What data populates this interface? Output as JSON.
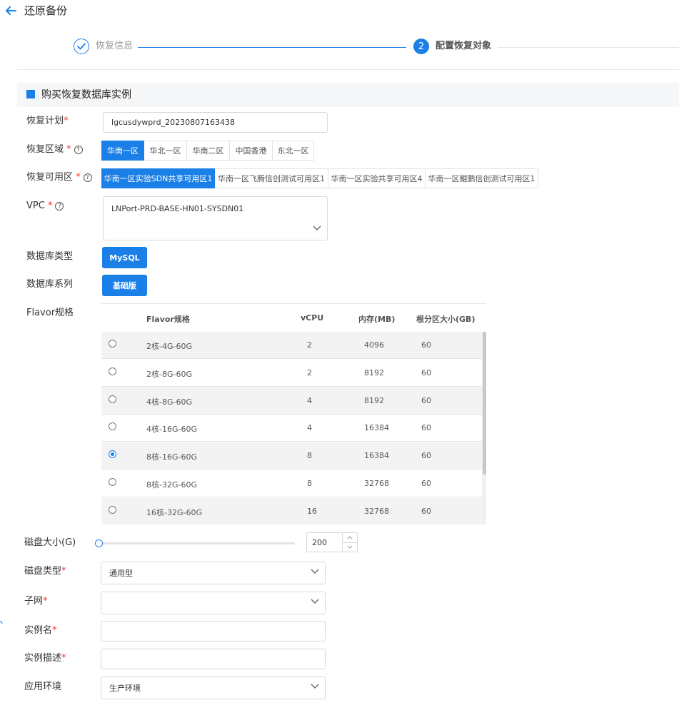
{
  "header": {
    "title": "还原备份",
    "back_icon": "arrow-left-icon"
  },
  "steps": [
    {
      "label": "恢复信息",
      "state": "done",
      "icon": "check-icon"
    },
    {
      "number": "2",
      "label": "配置恢复对象",
      "state": "active"
    }
  ],
  "section": {
    "title": "购买恢复数据库实例"
  },
  "form": {
    "plan": {
      "label": "恢复计划",
      "required_mark": "*",
      "value": "lgcusdywprd_20230807163438"
    },
    "region": {
      "label": "恢复区域",
      "required_mark": "*",
      "options": [
        "华南一区",
        "华北一区",
        "华南二区",
        "中国香港",
        "东北一区"
      ],
      "selected": "华南一区"
    },
    "zone": {
      "label": "恢复可用区",
      "required_mark": "*",
      "options": [
        "华南一区实验SDN共享可用区1",
        "华南一区飞腾信创测试可用区1",
        "华南一区实验共享可用区4",
        "华南一区鲲鹏信创测试可用区1"
      ],
      "selected": "华南一区实验SDN共享可用区1"
    },
    "vpc": {
      "label": "VPC",
      "required_mark": "*",
      "value": "LNPort-PRD-BASE-HN01-SYSDN01"
    },
    "db_type": {
      "label": "数据库类型",
      "value": "MySQL"
    },
    "db_series": {
      "label": "数据库系列",
      "value": "基础版"
    },
    "flavor": {
      "label": "Flavor规格",
      "columns": [
        "Flavor规格",
        "vCPU",
        "内存(MB)",
        "根分区大小(GB)"
      ],
      "rows": [
        {
          "name": "2核-4G-60G",
          "vcpu": "2",
          "mem": "4096",
          "disk": "60",
          "selected": false
        },
        {
          "name": "2核-8G-60G",
          "vcpu": "2",
          "mem": "8192",
          "disk": "60",
          "selected": false
        },
        {
          "name": "4核-8G-60G",
          "vcpu": "4",
          "mem": "8192",
          "disk": "60",
          "selected": false
        },
        {
          "name": "4核-16G-60G",
          "vcpu": "4",
          "mem": "16384",
          "disk": "60",
          "selected": false
        },
        {
          "name": "8核-16G-60G",
          "vcpu": "8",
          "mem": "16384",
          "disk": "60",
          "selected": true
        },
        {
          "name": "8核-32G-60G",
          "vcpu": "8",
          "mem": "32768",
          "disk": "60",
          "selected": false
        },
        {
          "name": "16核-32G-60G",
          "vcpu": "16",
          "mem": "32768",
          "disk": "60",
          "selected": false
        }
      ]
    },
    "disk_size": {
      "label": "磁盘大小(G)",
      "value": "200",
      "slider_fraction": 0
    },
    "disk_type": {
      "label": "磁盘类型",
      "required_mark": "*",
      "value": "通用型"
    },
    "subnet": {
      "label": "子网",
      "required_mark": "*",
      "value": ""
    },
    "instance_name": {
      "label": "实例名",
      "required_mark": "*",
      "value": ""
    },
    "instance_desc": {
      "label": "实例描述",
      "required_mark": "*",
      "value": ""
    },
    "environment": {
      "label": "应用环境",
      "value": "生产环境"
    }
  },
  "colors": {
    "accent": "#1a7fe6",
    "required": "#ee3333"
  }
}
